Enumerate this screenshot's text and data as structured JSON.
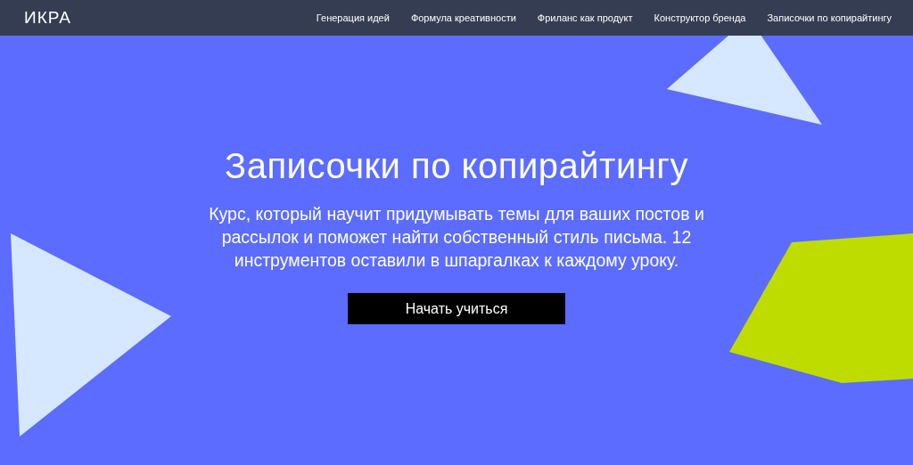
{
  "header": {
    "logo": "ИКРА",
    "nav": [
      {
        "label": "Генерация идей"
      },
      {
        "label": "Формула креативности"
      },
      {
        "label": "Фриланс как продукт"
      },
      {
        "label": "Конструктор бренда"
      },
      {
        "label": "Записочки по копирайтингу"
      }
    ]
  },
  "hero": {
    "title": "Записочки по копирайтингу",
    "description": "Курс, который научит придумывать темы для ваших постов и рассылок и поможет найти собственный стиль письма. 12 инструментов оставили в шпаргалках к каждому уроку.",
    "button": "Начать учиться"
  }
}
